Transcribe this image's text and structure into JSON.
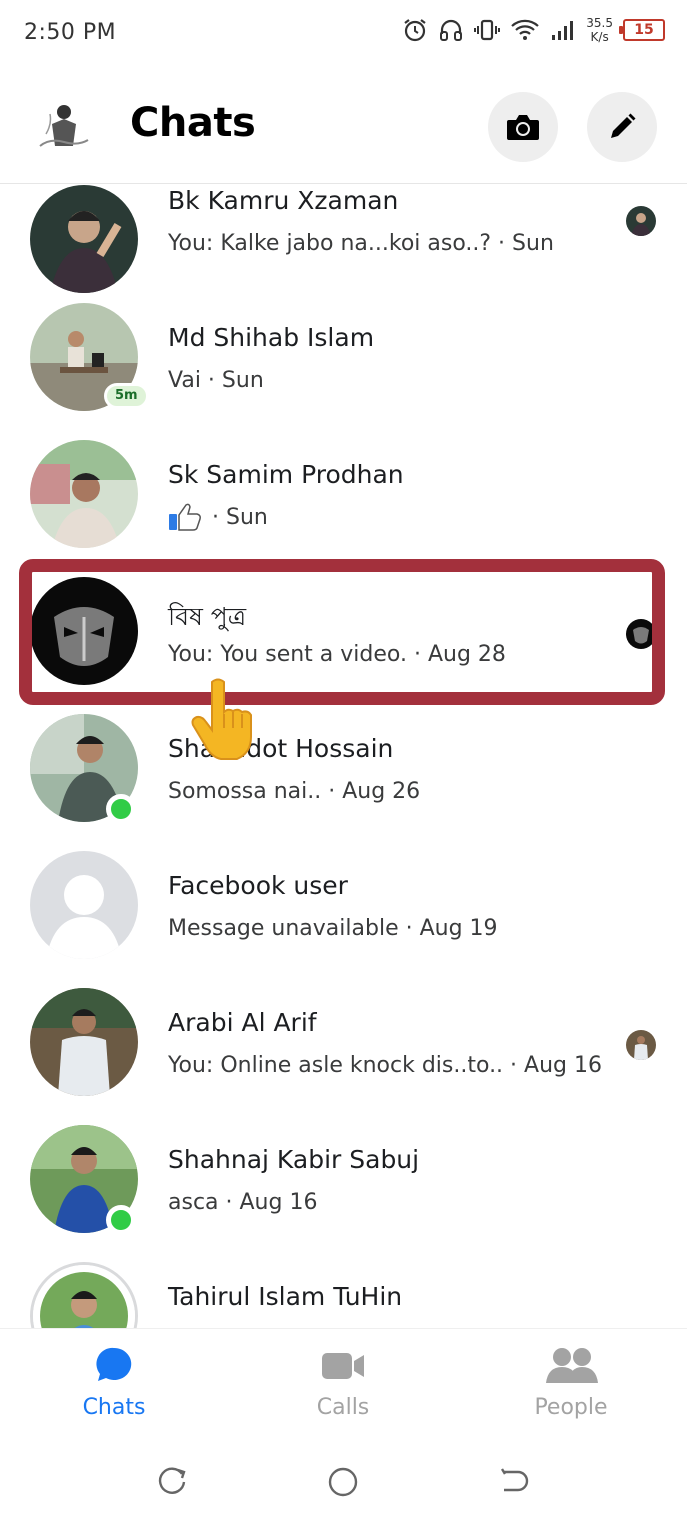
{
  "status_bar": {
    "time": "2:50 PM",
    "net_speed_value": "35.5",
    "net_speed_unit": "K/s",
    "battery_level": "15"
  },
  "header": {
    "title": "Chats",
    "icons": {
      "camera": "camera-icon",
      "compose": "pencil-icon"
    }
  },
  "chats": [
    {
      "name": "Bk Kamru Xzaman",
      "preview": "You: Kalke jabo na...koi aso..? · Sun",
      "status": "seen"
    },
    {
      "name": "Md Shihab Islam",
      "preview": "Vai · Sun",
      "active_badge": "5m"
    },
    {
      "name": "Sk Samim Prodhan",
      "preview": "· Sun",
      "preview_icon": "thumbs-up-icon"
    },
    {
      "name": "বিষ পুত্র",
      "preview": "You: You sent a video. · Aug 28",
      "status": "seen",
      "highlighted": true
    },
    {
      "name": "Shahadot Hossain",
      "preview": "Somossa nai.. · Aug 26",
      "online": true
    },
    {
      "name": "Facebook user",
      "preview": "Message unavailable · Aug 19"
    },
    {
      "name": "Arabi Al Arif",
      "preview": "You: Online asle knock dis..to.. · Aug 16",
      "status": "seen"
    },
    {
      "name": "Shahnaj Kabir Sabuj",
      "preview": "asca · Aug 16",
      "online": true
    },
    {
      "name": "Tahirul Islam TuHin",
      "preview": ""
    }
  ],
  "bottom_nav": {
    "chats": "Chats",
    "calls": "Calls",
    "people": "People",
    "active": "chats",
    "accent_color": "#1877f2",
    "inactive_color": "#a3a3a3"
  },
  "system_nav": {
    "icons": [
      "recent-apps-icon",
      "home-icon",
      "back-icon"
    ]
  },
  "colors": {
    "highlight_border": "#a3303c",
    "online": "#31cc46"
  }
}
